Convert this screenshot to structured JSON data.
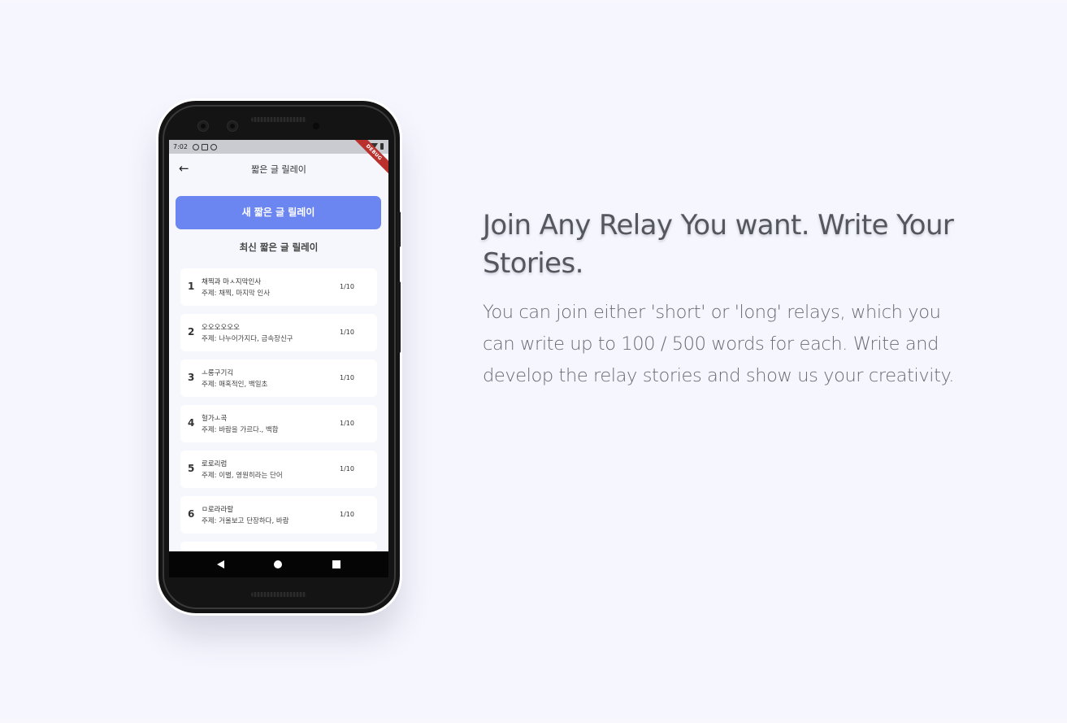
{
  "phone": {
    "status_bar": {
      "time": "7:02",
      "icons": [
        "C",
        "▣",
        "◎"
      ],
      "debug_banner": "DEBUG"
    },
    "app_bar": {
      "title": "짧은 글 릴레이",
      "back_icon": "arrow-left-icon"
    },
    "new_relay_button": "새 짧은 글 릴레이",
    "section_title": "최신 짧은 글 릴레이",
    "relays": [
      {
        "num": "1",
        "title": "채찍과 마ㅅ지막인사",
        "topic": "주제: 채찍, 마지막 인사",
        "count": "1/10"
      },
      {
        "num": "2",
        "title": "오오오오오오",
        "topic": "주제: 나누어가지다, 금속장신구",
        "count": "1/10"
      },
      {
        "num": "3",
        "title": "ㅗ롱구기긱",
        "topic": "주제: 매혹적인, 백일초",
        "count": "1/10"
      },
      {
        "num": "4",
        "title": "헐가ㅗ곡",
        "topic": "주제: 바람을 가르다., 백합",
        "count": "1/10"
      },
      {
        "num": "5",
        "title": "로로리럼",
        "topic": "주제: 이별, 영원히라는 단어",
        "count": "1/10"
      },
      {
        "num": "6",
        "title": "ㅁ로라라랄",
        "topic": "주제: 거울보고 단장하다, 바람",
        "count": "1/10"
      }
    ],
    "nav": {
      "back_icon": "nav-back-icon",
      "home_icon": "nav-home-icon",
      "recent_icon": "nav-recents-icon"
    }
  },
  "content": {
    "headline": "Join Any Relay You want. Write Your Stories.",
    "description": "You can join either 'short' or 'long' relays, which you can write up to 100 / 500 words for each. Write and develop the relay stories and show us your creativity."
  },
  "colors": {
    "background": "#f5f6fe",
    "accent": "#6b86f1",
    "headline": "#55575f",
    "body_text": "#6a6c74"
  }
}
